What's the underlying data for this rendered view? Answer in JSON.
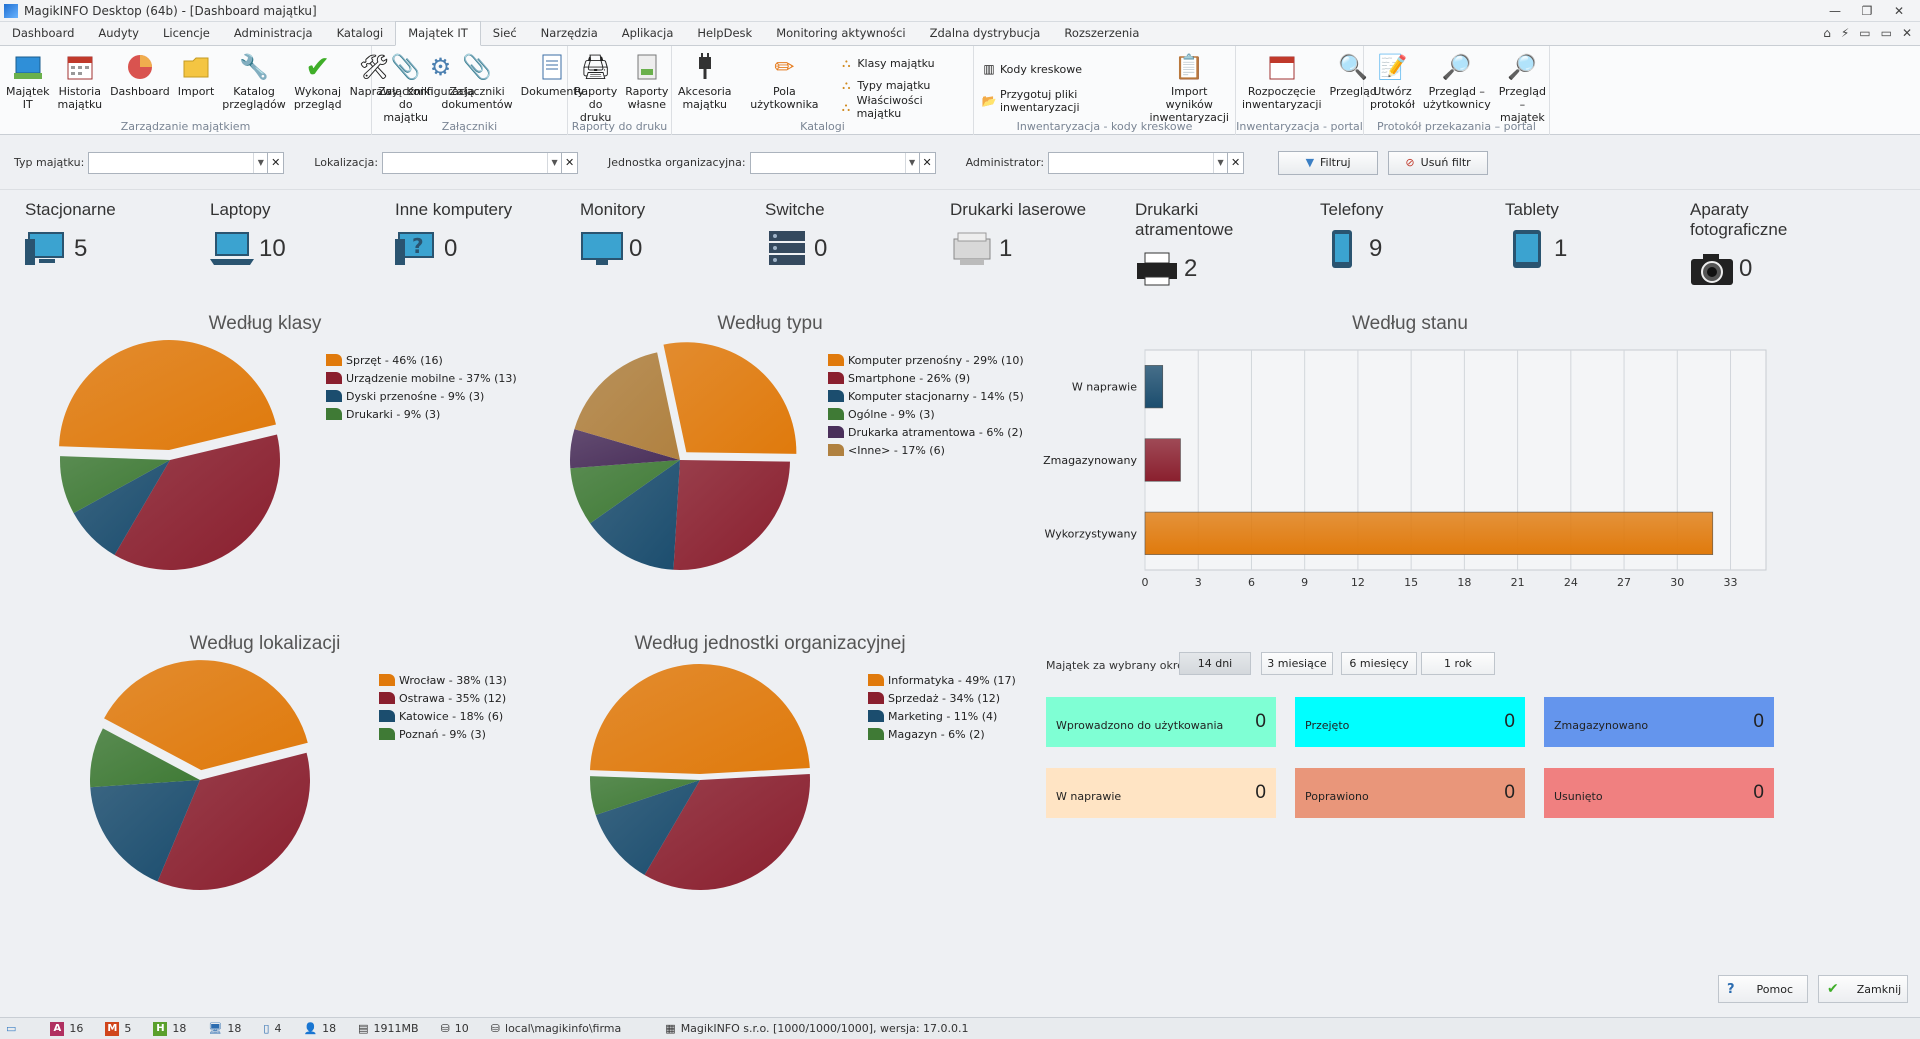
{
  "window": {
    "title": "MagikINFO Desktop (64b) - [Dashboard majątku]",
    "controls": [
      "⌂",
      "⚡",
      "▭",
      "▭",
      "✕"
    ]
  },
  "menu": {
    "tabs": [
      "Dashboard",
      "Audyty",
      "Licencje",
      "Administracja",
      "Katalogi",
      "Majątek IT",
      "Sieć",
      "Narzędzia",
      "Aplikacja",
      "HelpDesk",
      "Monitoring aktywności",
      "Zdalna dystrybucja",
      "Rozszerzenia"
    ],
    "active": "Majątek IT"
  },
  "ribbon": {
    "g1": {
      "name": "Zarządzanie majątkiem",
      "buttons": [
        "Majątek\nIT",
        "Historia\nmajątku",
        "Dashboard",
        "Import",
        "Katalog\nprzeglądów",
        "Wykonaj\nprzegląd",
        "Naprawy",
        "Konfiguracja"
      ]
    },
    "g2": {
      "name": "Załączniki",
      "buttons": [
        "Załączniki\ndo majątku",
        "Załączniki\ndokumentów",
        "Dokumenty"
      ]
    },
    "g3": {
      "name": "Raporty do druku",
      "buttons": [
        "Raporty\ndo druku",
        "Raporty\nwłasne"
      ]
    },
    "g4": {
      "name": "Katalogi",
      "buttons": [
        "Akcesoria\nmajątku",
        "Pola użytkownika"
      ],
      "small": [
        "Klasy majątku",
        "Typy majątku",
        "Właściwości majątku"
      ]
    },
    "g5": {
      "name": "Inwentaryzacja - kody kreskowe",
      "small": [
        "Kody kreskowe",
        "Przygotuj pliki inwentaryzacji"
      ],
      "buttons": [
        "Import wyników\ninwentaryzacji"
      ]
    },
    "g6": {
      "name": "Inwentaryzacja - portal",
      "buttons": [
        "Rozpoczęcie\ninwentaryzacji",
        "Przegląd"
      ]
    },
    "g7": {
      "name": "Protokół przekazania – portal",
      "buttons": [
        "Utwórz\nprotokół",
        "Przegląd –\nużytkownicy",
        "Przegląd\n– majątek"
      ]
    }
  },
  "filters": {
    "type_label": "Typ majątku:",
    "location_label": "Lokalizacja:",
    "unit_label": "Jednostka organizacyjna:",
    "admin_label": "Administrator:",
    "filter_btn": "Filtruj",
    "remove_btn": "Usuń filtr"
  },
  "categories": [
    {
      "name": "Stacjonarne",
      "count": "5"
    },
    {
      "name": "Laptopy",
      "count": "10"
    },
    {
      "name": "Inne komputery",
      "count": "0"
    },
    {
      "name": "Monitory",
      "count": "0"
    },
    {
      "name": "Switche",
      "count": "0"
    },
    {
      "name": "Drukarki laserowe",
      "count": "1"
    },
    {
      "name": "Drukarki atramentowe",
      "count": "2"
    },
    {
      "name": "Telefony",
      "count": "9"
    },
    {
      "name": "Tablety",
      "count": "1"
    },
    {
      "name": "Aparaty fotograficzne",
      "count": "0"
    }
  ],
  "colors": {
    "orange": "#e07a0c",
    "red": "#8a1f2e",
    "blue": "#1b4d6e",
    "green": "#3f7a35",
    "purple": "#4a2f5a",
    "tan": "#b08140"
  },
  "pie_class": {
    "title": "Według klasy",
    "legend": [
      "Sprzęt - 46% (16)",
      "Urządzenie mobilne - 37% (13)",
      "Dyski przenośne - 9% (3)",
      "Drukarki - 9% (3)"
    ]
  },
  "pie_type": {
    "title": "Według typu",
    "legend": [
      "Komputer przenośny - 29% (10)",
      "Smartphone - 26% (9)",
      "Komputer stacjonarny - 14% (5)",
      "Ogólne - 9% (3)",
      "Drukarka atramentowa - 6% (2)",
      "<Inne> - 17% (6)"
    ]
  },
  "pie_loc": {
    "title": "Według lokalizacji",
    "legend": [
      "Wrocław - 38% (13)",
      "Ostrawa - 35% (12)",
      "Katowice - 18% (6)",
      "Poznań - 9% (3)"
    ]
  },
  "pie_unit": {
    "title": "Według jednostki organizacyjnej",
    "legend": [
      "Informatyka - 49% (17)",
      "Sprzedaż - 34% (12)",
      "Marketing - 11% (4)",
      "Magazyn - 6% (2)"
    ]
  },
  "chart_data": [
    {
      "type": "pie",
      "title": "Według klasy",
      "categories": [
        "Sprzęt",
        "Urządzenie mobilne",
        "Dyski przenośne",
        "Drukarki"
      ],
      "values": [
        16,
        13,
        3,
        3
      ]
    },
    {
      "type": "pie",
      "title": "Według typu",
      "categories": [
        "Komputer przenośny",
        "Smartphone",
        "Komputer stacjonarny",
        "Ogólne",
        "Drukarka atramentowa",
        "<Inne>"
      ],
      "values": [
        10,
        9,
        5,
        3,
        2,
        6
      ]
    },
    {
      "type": "pie",
      "title": "Według lokalizacji",
      "categories": [
        "Wrocław",
        "Ostrawa",
        "Katowice",
        "Poznań"
      ],
      "values": [
        13,
        12,
        6,
        3
      ]
    },
    {
      "type": "pie",
      "title": "Według jednostki organizacyjnej",
      "categories": [
        "Informatyka",
        "Sprzedaż",
        "Marketing",
        "Magazyn"
      ],
      "values": [
        17,
        12,
        4,
        2
      ]
    },
    {
      "type": "bar",
      "orientation": "horizontal",
      "title": "Według stanu",
      "categories": [
        "W naprawie",
        "Zmagazynowany",
        "Wykorzystywany"
      ],
      "values": [
        1,
        2,
        32
      ],
      "xticks": [
        "0",
        "3",
        "6",
        "9",
        "12",
        "15",
        "18",
        "21",
        "24",
        "27",
        "30",
        "33"
      ],
      "xlim": [
        0,
        35
      ],
      "grid": true
    }
  ],
  "period": {
    "label": "Majątek za wybrany okres",
    "options": [
      "14 dni",
      "3 miesiące",
      "6 miesięcy",
      "1 rok"
    ],
    "selected": "14 dni"
  },
  "tiles": [
    {
      "label": "Wprowadzono do użytkowania",
      "value": "0",
      "color": "#7fffd4"
    },
    {
      "label": "Przejęto",
      "value": "0",
      "color": "#00ffff"
    },
    {
      "label": "Zmagazynowano",
      "value": "0",
      "color": "#6495ed"
    },
    {
      "label": "W naprawie",
      "value": "0",
      "color": "#ffe4c4"
    },
    {
      "label": "Poprawiono",
      "value": "0",
      "color": "#e9967a"
    },
    {
      "label": "Usunięto",
      "value": "0",
      "color": "#f08080"
    }
  ],
  "footer": {
    "help": "Pomoc",
    "close": "Zamknij"
  },
  "status": {
    "a": "16",
    "m": "5",
    "h": "18",
    "pc": "18",
    "mobile": "4",
    "users": "18",
    "mem": "1911MB",
    "db": "10",
    "db_path": "local\\magikinfo\\firma",
    "version": "MagikINFO s.r.o. [1000/1000/1000], wersja: 17.0.0.1"
  }
}
